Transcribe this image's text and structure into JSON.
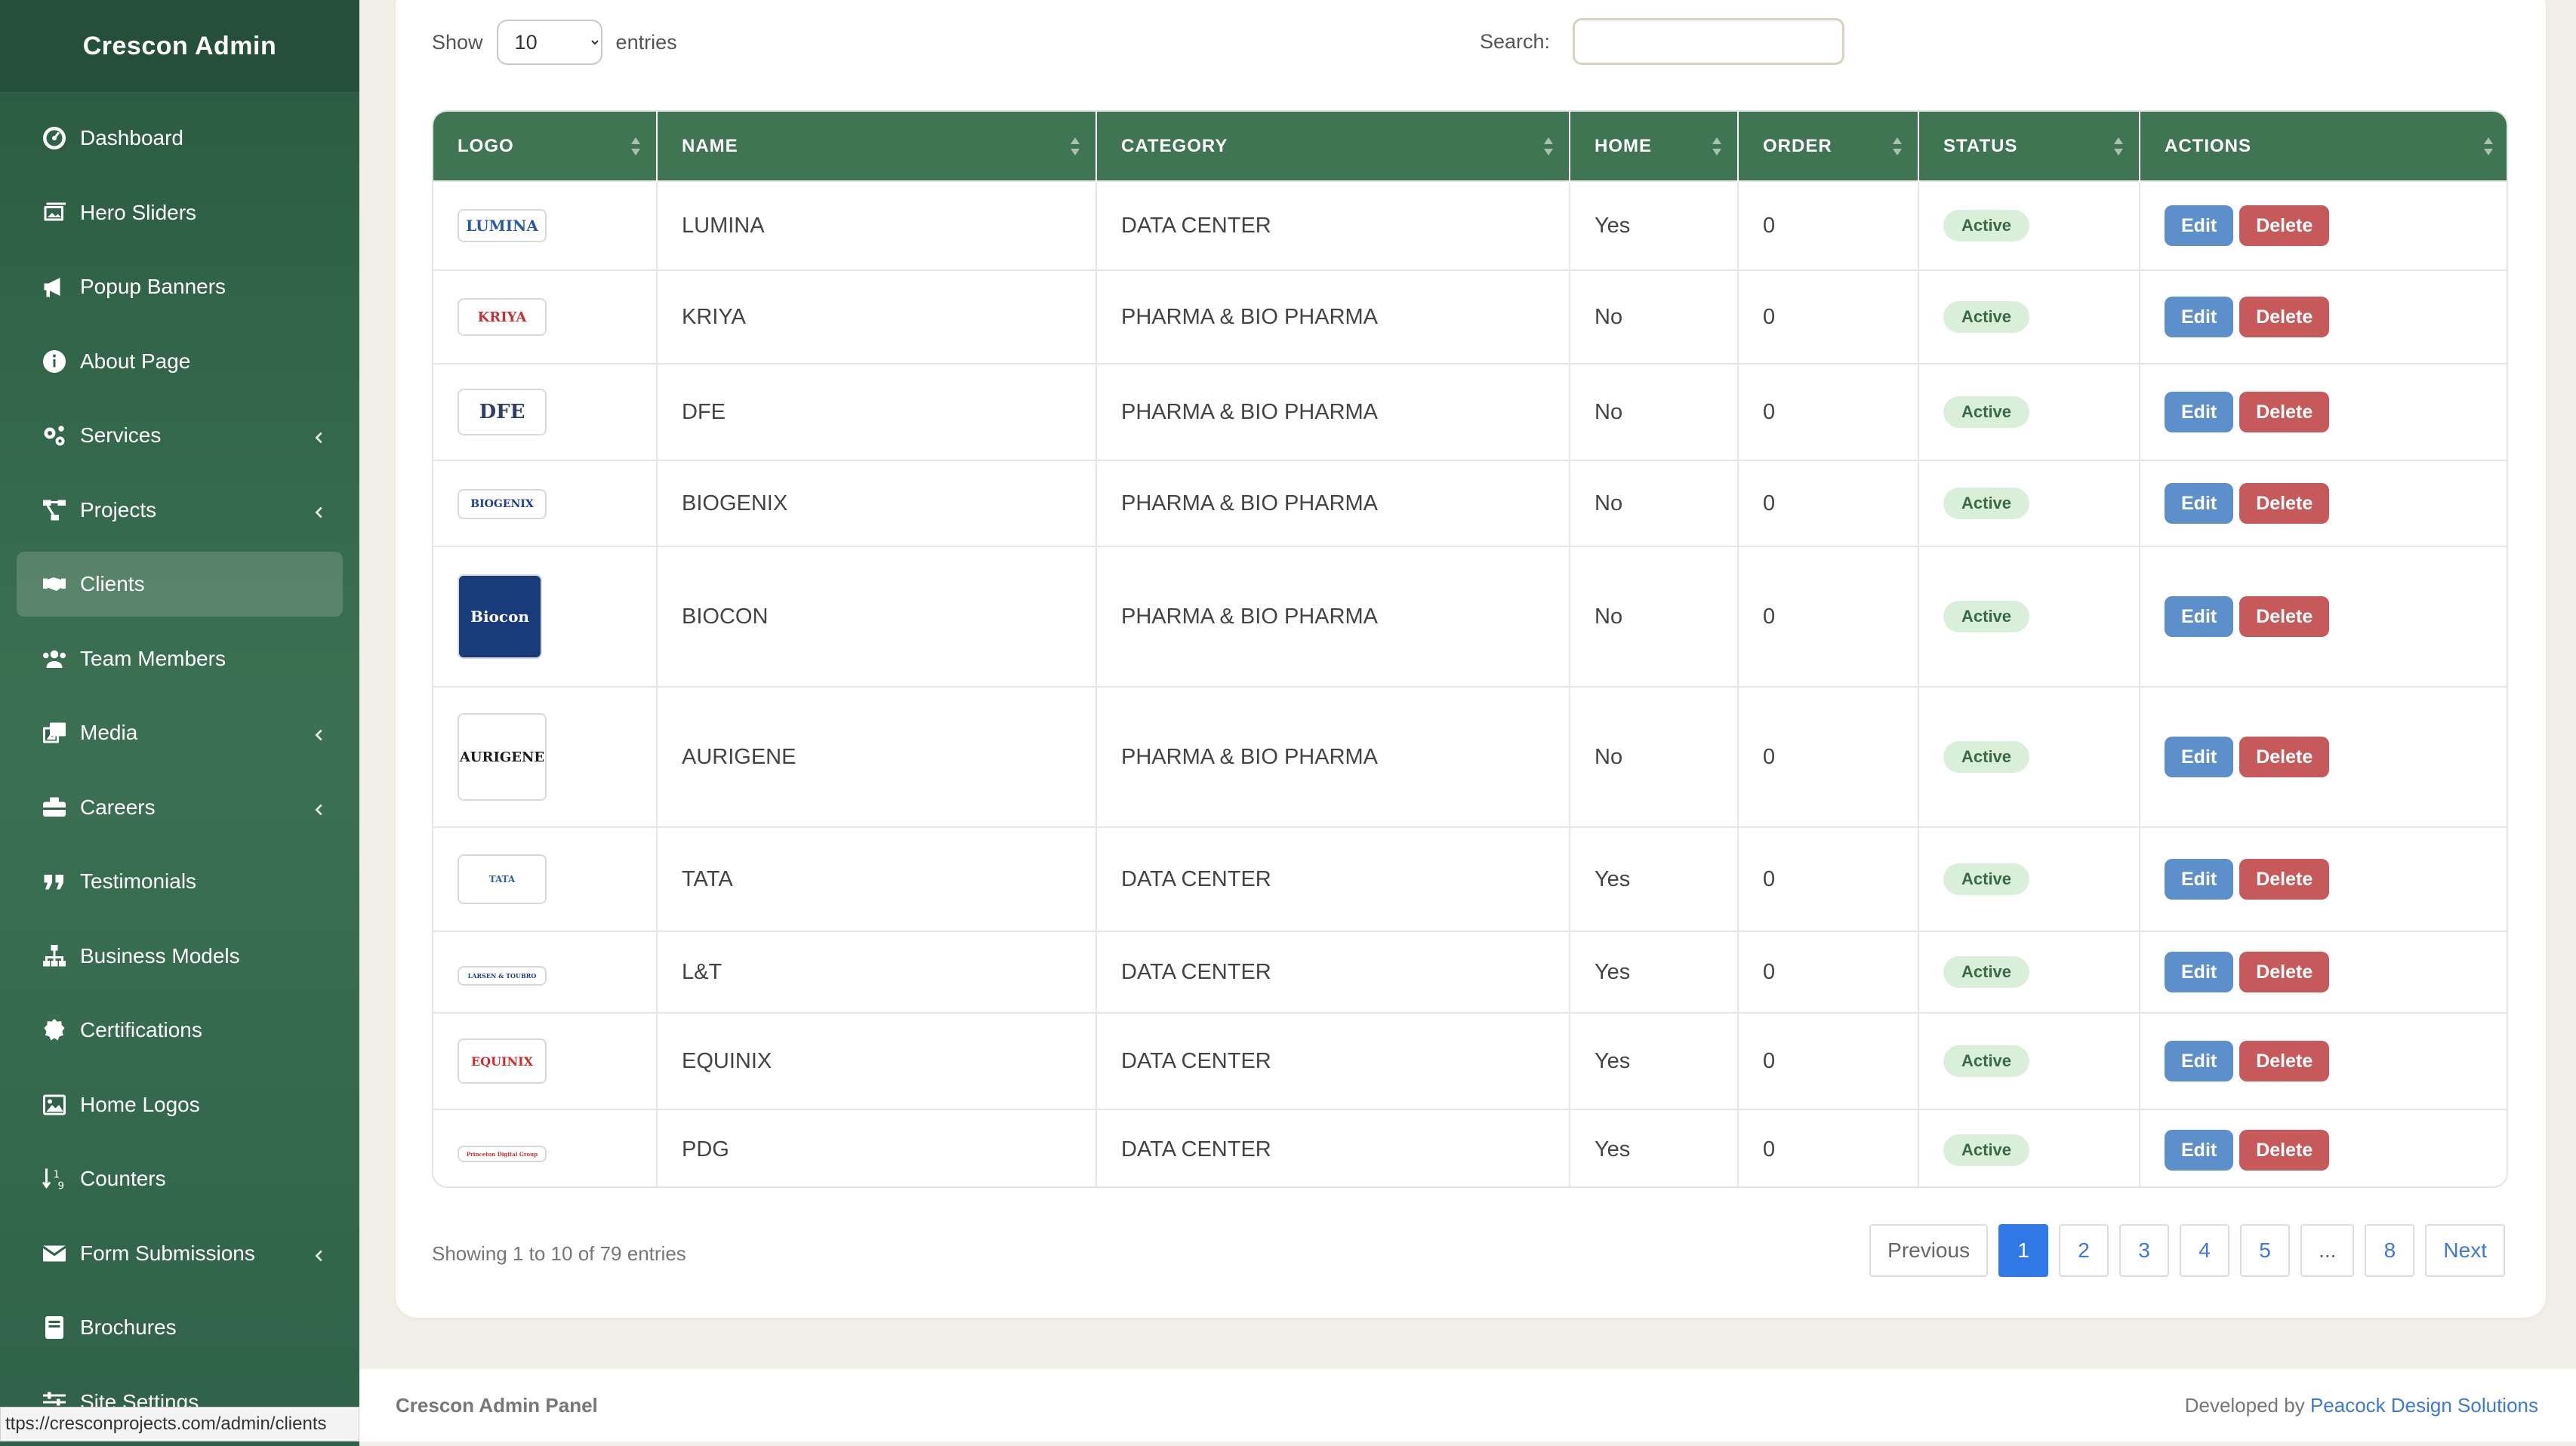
{
  "sidebar": {
    "brand": "Crescon Admin",
    "items": [
      {
        "label": "Dashboard",
        "icon": "dashboard-icon",
        "chevron": false,
        "active": false
      },
      {
        "label": "Hero Sliders",
        "icon": "images-icon",
        "chevron": false,
        "active": false
      },
      {
        "label": "Popup Banners",
        "icon": "bullhorn-icon",
        "chevron": false,
        "active": false
      },
      {
        "label": "About Page",
        "icon": "info-circle-icon",
        "chevron": false,
        "active": false
      },
      {
        "label": "Services",
        "icon": "cogs-icon",
        "chevron": true,
        "active": false
      },
      {
        "label": "Projects",
        "icon": "project-diagram-icon",
        "chevron": true,
        "active": false
      },
      {
        "label": "Clients",
        "icon": "handshake-icon",
        "chevron": false,
        "active": true
      },
      {
        "label": "Team Members",
        "icon": "users-icon",
        "chevron": false,
        "active": false
      },
      {
        "label": "Media",
        "icon": "photo-video-icon",
        "chevron": true,
        "active": false
      },
      {
        "label": "Careers",
        "icon": "briefcase-icon",
        "chevron": true,
        "active": false
      },
      {
        "label": "Testimonials",
        "icon": "quote-icon",
        "chevron": false,
        "active": false
      },
      {
        "label": "Business Models",
        "icon": "sitemap-icon",
        "chevron": false,
        "active": false
      },
      {
        "label": "Certifications",
        "icon": "certificate-icon",
        "chevron": false,
        "active": false
      },
      {
        "label": "Home Logos",
        "icon": "image-icon",
        "chevron": false,
        "active": false
      },
      {
        "label": "Counters",
        "icon": "sort-numeric-icon",
        "chevron": false,
        "active": false
      },
      {
        "label": "Form Submissions",
        "icon": "envelope-icon",
        "chevron": true,
        "active": false
      },
      {
        "label": "Brochures",
        "icon": "book-icon",
        "chevron": false,
        "active": false
      },
      {
        "label": "Site Settings",
        "icon": "sliders-icon",
        "chevron": false,
        "active": false
      }
    ]
  },
  "status_url": "ttps://cresconprojects.com/admin/clients",
  "toolbar": {
    "show_label": "Show",
    "entries_value": "10",
    "entries_label": "entries",
    "search_label": "Search:",
    "search_value": ""
  },
  "table": {
    "headers": [
      "LOGO",
      "NAME",
      "CATEGORY",
      "HOME",
      "ORDER",
      "STATUS",
      "ACTIONS"
    ],
    "edit_label": "Edit",
    "delete_label": "Delete",
    "rows": [
      {
        "logo_text": "LUMINA",
        "logo_color": "#2b5aa8",
        "name": "LUMINA",
        "category": "DATA CENTER",
        "home": "Yes",
        "order": "0",
        "status": "Active"
      },
      {
        "logo_text": "KRIYA",
        "logo_color": "#c43232",
        "name": "KRIYA",
        "category": "PHARMA & BIO PHARMA",
        "home": "No",
        "order": "0",
        "status": "Active"
      },
      {
        "logo_text": "DFE",
        "logo_color": "#2f3f66",
        "name": "DFE",
        "category": "PHARMA & BIO PHARMA",
        "home": "No",
        "order": "0",
        "status": "Active"
      },
      {
        "logo_text": "BIOGENIX",
        "logo_color": "#1f3e8f",
        "name": "BIOGENIX",
        "category": "PHARMA & BIO PHARMA",
        "home": "No",
        "order": "0",
        "status": "Active"
      },
      {
        "logo_text": "Biocon",
        "logo_color": "#ffffff",
        "name": "BIOCON",
        "category": "PHARMA & BIO PHARMA",
        "home": "No",
        "order": "0",
        "status": "Active"
      },
      {
        "logo_text": "AURIGENE",
        "logo_color": "#1a1a1a",
        "name": "AURIGENE",
        "category": "PHARMA & BIO PHARMA",
        "home": "No",
        "order": "0",
        "status": "Active"
      },
      {
        "logo_text": "TATA",
        "logo_color": "#2a62b0",
        "name": "TATA",
        "category": "DATA CENTER",
        "home": "Yes",
        "order": "0",
        "status": "Active"
      },
      {
        "logo_text": "LARSEN & TOUBRO",
        "logo_color": "#1f3e8f",
        "name": "L&T",
        "category": "DATA CENTER",
        "home": "Yes",
        "order": "0",
        "status": "Active"
      },
      {
        "logo_text": "EQUINIX",
        "logo_color": "#d02a2a",
        "name": "EQUINIX",
        "category": "DATA CENTER",
        "home": "Yes",
        "order": "0",
        "status": "Active"
      },
      {
        "logo_text": "Princeton Digital Group",
        "logo_color": "#c43232",
        "name": "PDG",
        "category": "DATA CENTER",
        "home": "Yes",
        "order": "0",
        "status": "Active"
      }
    ]
  },
  "info": "Showing 1 to 10 of 79 entries",
  "pagination": {
    "previous": "Previous",
    "pages": [
      "1",
      "2",
      "3",
      "4",
      "5",
      "...",
      "8"
    ],
    "current": "1",
    "next": "Next"
  },
  "footer": {
    "left": "Crescon Admin Panel",
    "right_prefix": "Developed by ",
    "right_link": "Peacock Design Solutions"
  },
  "colors": {
    "sidebar": "#2f6248",
    "header": "#3f7552",
    "edit": "#5d8fcb",
    "delete": "#c65a5a",
    "active_badge": "#d9efd9",
    "page_current": "#2f78e6"
  }
}
